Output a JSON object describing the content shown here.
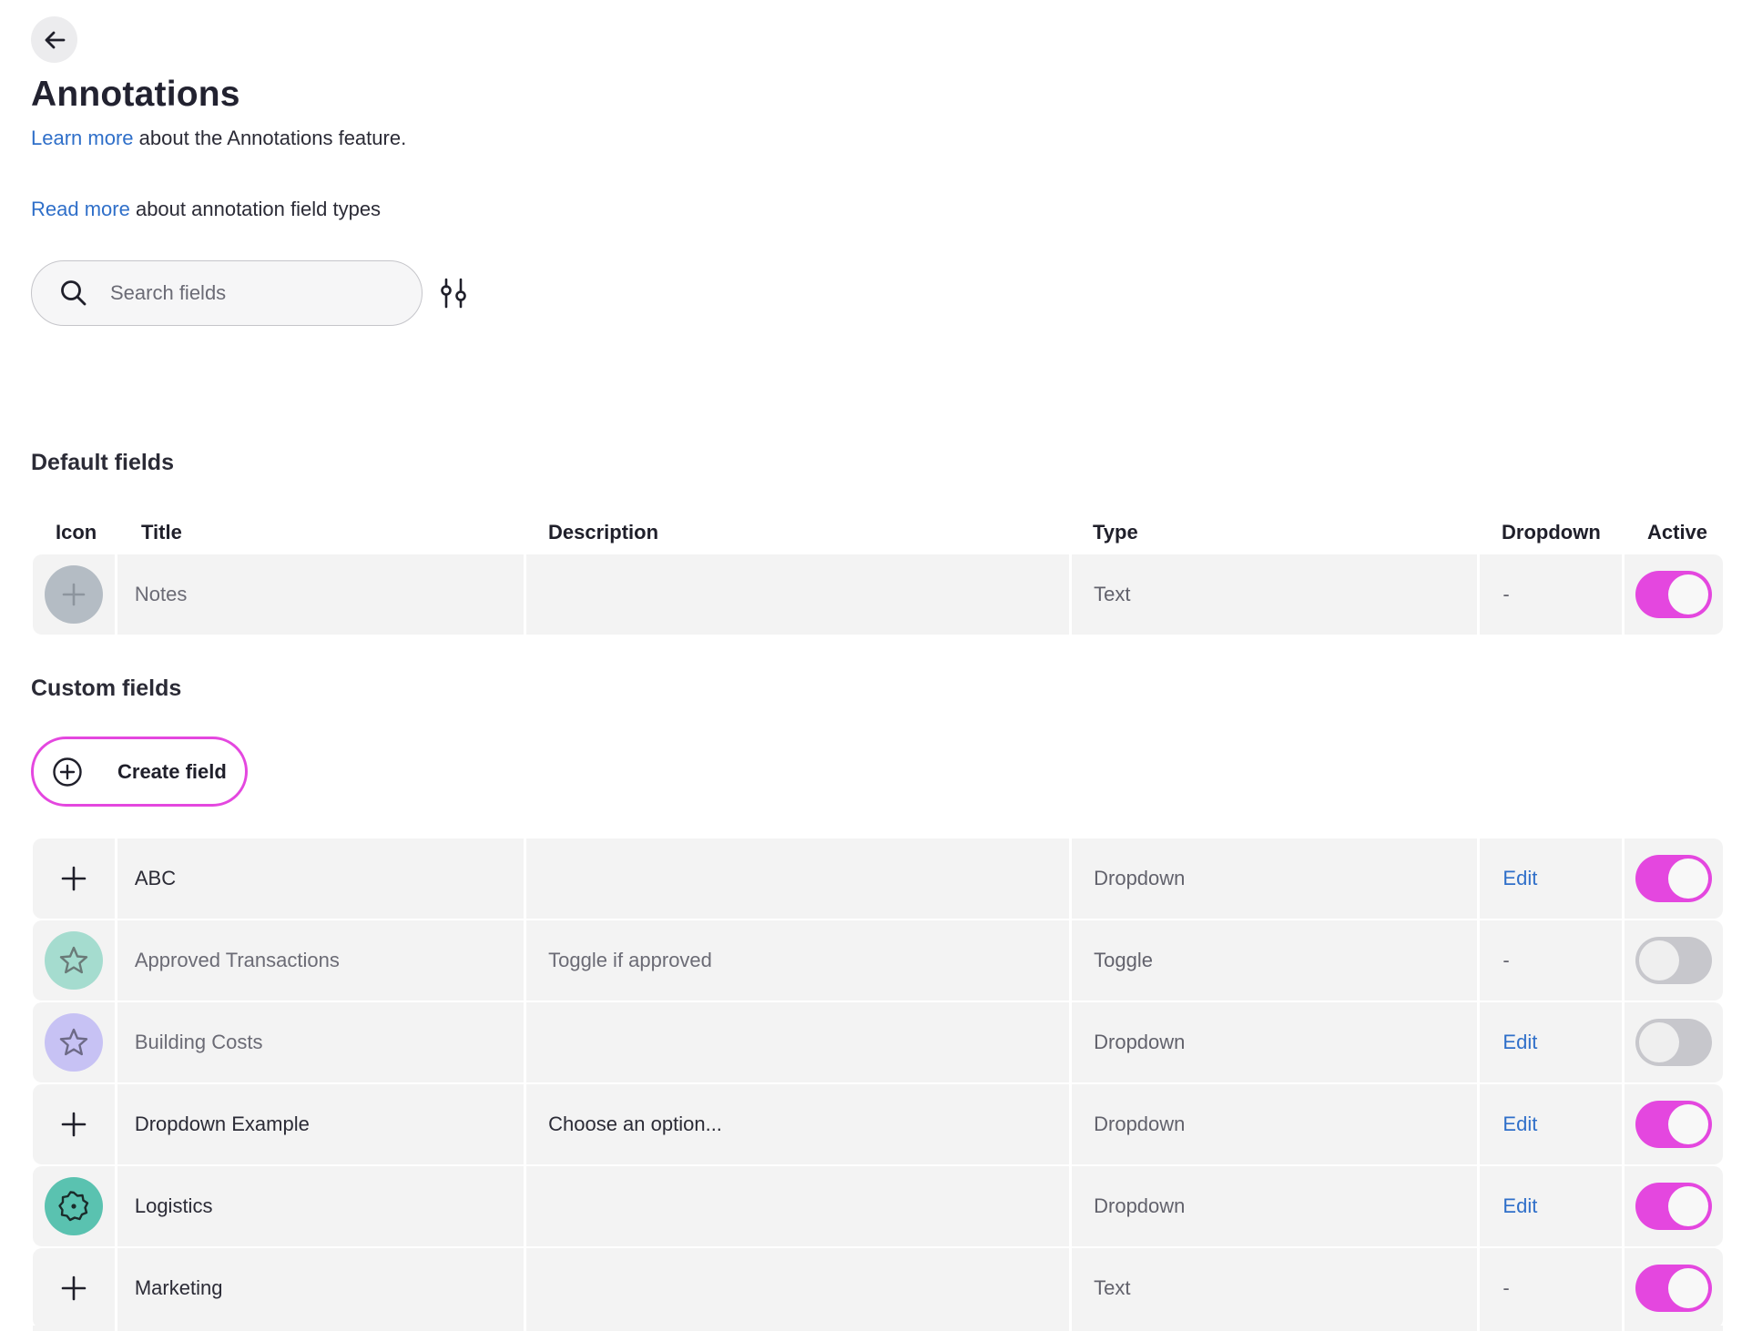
{
  "header": {
    "back_label": "Back",
    "title": "Annotations",
    "intro_link": "Learn more",
    "intro_text": " about the Annotations feature.",
    "types_link": "Read more",
    "types_text": " about annotation field types"
  },
  "search": {
    "placeholder": "Search fields",
    "value": ""
  },
  "sections": {
    "default_title": "Default fields",
    "custom_title": "Custom fields"
  },
  "table_headers": {
    "icon": "Icon",
    "title": "Title",
    "description": "Description",
    "type": "Type",
    "dropdown": "Dropdown",
    "active": "Active"
  },
  "colors": {
    "accent": "#e447df",
    "link": "#2f6fc9",
    "toggle_off": "#c7c7cc"
  },
  "default_fields": [
    {
      "icon": "plus-icon",
      "icon_bg": "#b4bcc4",
      "title": "Notes",
      "description": "",
      "type": "Text",
      "dropdown": "-",
      "active": true
    }
  ],
  "create_button": {
    "label": "Create field"
  },
  "custom_fields": [
    {
      "icon": "plus-icon",
      "icon_bg": "",
      "title": "ABC",
      "description": "",
      "type": "Dropdown",
      "dropdown": "Edit",
      "active": true
    },
    {
      "icon": "star-icon",
      "icon_bg": "#a5dccf",
      "title": "Approved Transactions",
      "description": "Toggle if approved",
      "type": "Toggle",
      "dropdown": "-",
      "active": false
    },
    {
      "icon": "star-icon",
      "icon_bg": "#c7c2f4",
      "title": "Building Costs",
      "description": "",
      "type": "Dropdown",
      "dropdown": "Edit",
      "active": false
    },
    {
      "icon": "plus-icon",
      "icon_bg": "",
      "title": "Dropdown Example",
      "description": "Choose an option...",
      "type": "Dropdown",
      "dropdown": "Edit",
      "active": true
    },
    {
      "icon": "badge-icon",
      "icon_bg": "#5ac2b0",
      "title": "Logistics",
      "description": "",
      "type": "Dropdown",
      "dropdown": "Edit",
      "active": true
    },
    {
      "icon": "plus-icon",
      "icon_bg": "",
      "title": "Marketing",
      "description": "",
      "type": "Text",
      "dropdown": "-",
      "active": true
    }
  ]
}
